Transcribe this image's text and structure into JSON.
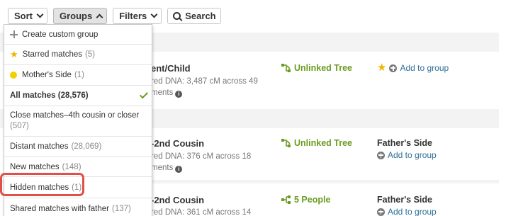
{
  "toolbar": {
    "sort_label": "Sort",
    "groups_label": "Groups",
    "filters_label": "Filters",
    "search_label": "Search"
  },
  "groups_dropdown": {
    "items": [
      {
        "label": "Create custom group",
        "count": "",
        "icon": "plus-icon"
      },
      {
        "label": "Starred matches",
        "count": "(5)",
        "icon": "star-icon"
      },
      {
        "label": "Mother's Side",
        "count": "(1)",
        "icon": "yellow-dot-icon"
      },
      {
        "label": "All matches (28,576)",
        "count": "",
        "selected": true
      },
      {
        "label": "Close matches–4th cousin or closer",
        "count": "(507)"
      },
      {
        "label": "Distant matches",
        "count": "(28,069)"
      },
      {
        "label": "New matches",
        "count": "(148)"
      },
      {
        "label": "Hidden matches",
        "count": "(1)",
        "highlighted": true
      },
      {
        "label": "Shared matches with father",
        "count": "(137)"
      }
    ]
  },
  "matches": [
    {
      "relationship": "ent/Child",
      "dna_line1": "red DNA: 3,487 cM across 49",
      "dna_line2": "ments",
      "tree_label": "Unlinked Tree",
      "side_label": "",
      "add_group": "Add to group",
      "starred": true
    },
    {
      "relationship": "-2nd Cousin",
      "dna_line1": "red DNA: 376 cM across 18",
      "dna_line2": "ments",
      "tree_label": "Unlinked Tree",
      "side_label": "Father's Side",
      "add_group": "Add to group"
    },
    {
      "relationship": "-2nd Cousin",
      "dna_line1": "red DNA: 361 cM across 14",
      "tree_label": "5 People",
      "side_label": "Father's Side",
      "add_group": "Add to group"
    }
  ],
  "colors": {
    "accent_green": "#6a9c20",
    "link_blue": "#2e6f98",
    "highlight_red": "#e0504a",
    "star_yellow": "#f0b400"
  }
}
